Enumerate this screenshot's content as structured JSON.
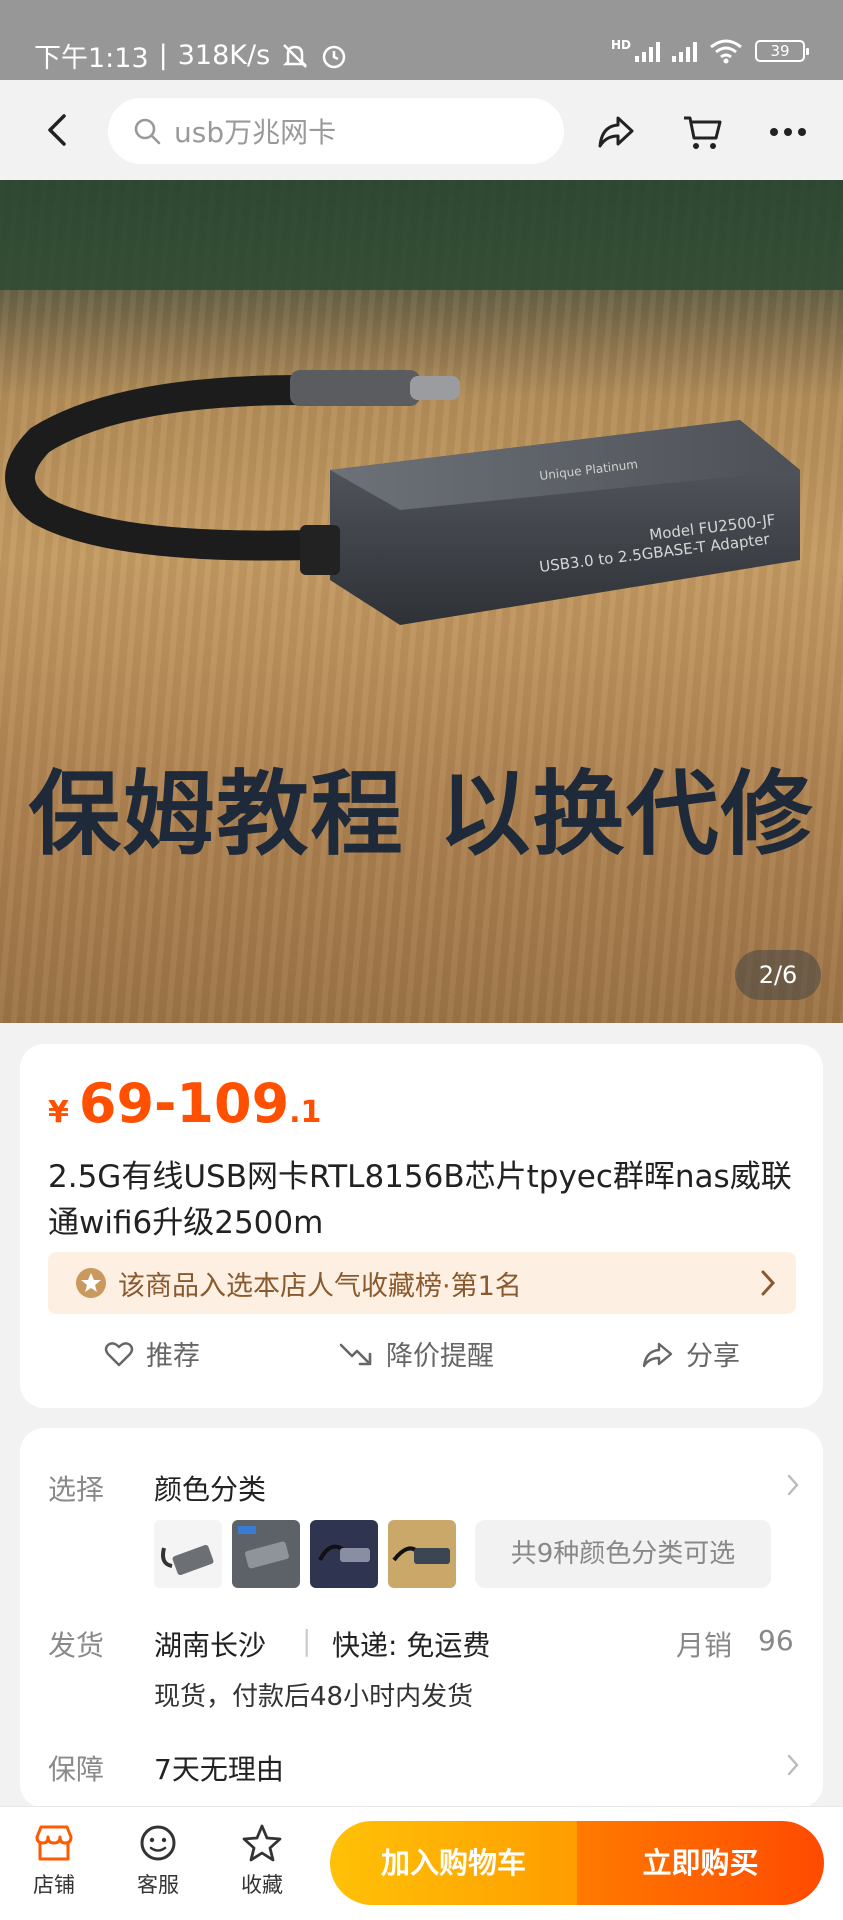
{
  "status_bar": {
    "time": "下午1:13",
    "separator": "|",
    "speed": "318K/s",
    "network": "HD",
    "battery": "39"
  },
  "nav": {
    "search_text": "usb万兆网卡",
    "icons": [
      "back-icon",
      "search-icon",
      "share-icon",
      "cart-icon",
      "more-icon"
    ]
  },
  "hero": {
    "caption": "保姆教程 以换代修",
    "counter": "2/6",
    "product_text_line1": "Model FU2500-JF",
    "product_text_line2": "USB3.0 to 2.5GBASE-T Adapter",
    "product_brand": "Unique Platinum"
  },
  "product": {
    "price_currency": "¥",
    "price_main": "69-109",
    "price_decimal": ".1",
    "title": "2.5G有线USB网卡RTL8156B芯片tpyec群晖nas威联通wifi6升级2500m",
    "rank_text": "该商品入选本店人气收藏榜·第1名",
    "actions": {
      "recommend": "推荐",
      "price_alert": "降价提醒",
      "share": "分享"
    }
  },
  "options": {
    "select_label": "选择",
    "select_value": "颜色分类",
    "more_colors": "共9种颜色分类可选",
    "ship_label": "发货",
    "ship_from": "湖南长沙",
    "ship_sep": "|",
    "ship_method": "快递: 免运费",
    "monthly_sales_label": "月销",
    "monthly_sales": "96",
    "ship_note": "现货，付款后48小时内发货",
    "guarantee_label": "保障",
    "guarantee_value": "7天无理由"
  },
  "bottom_bar": {
    "shop": "店铺",
    "service": "客服",
    "favorite": "收藏",
    "add_to_cart": "加入购物车",
    "buy_now": "立即购买"
  },
  "colors": {
    "accent": "#ff4f00",
    "cart_button": "#ffb300",
    "buy_button": "#ff5a00",
    "shop_icon": "#ff5a00"
  }
}
